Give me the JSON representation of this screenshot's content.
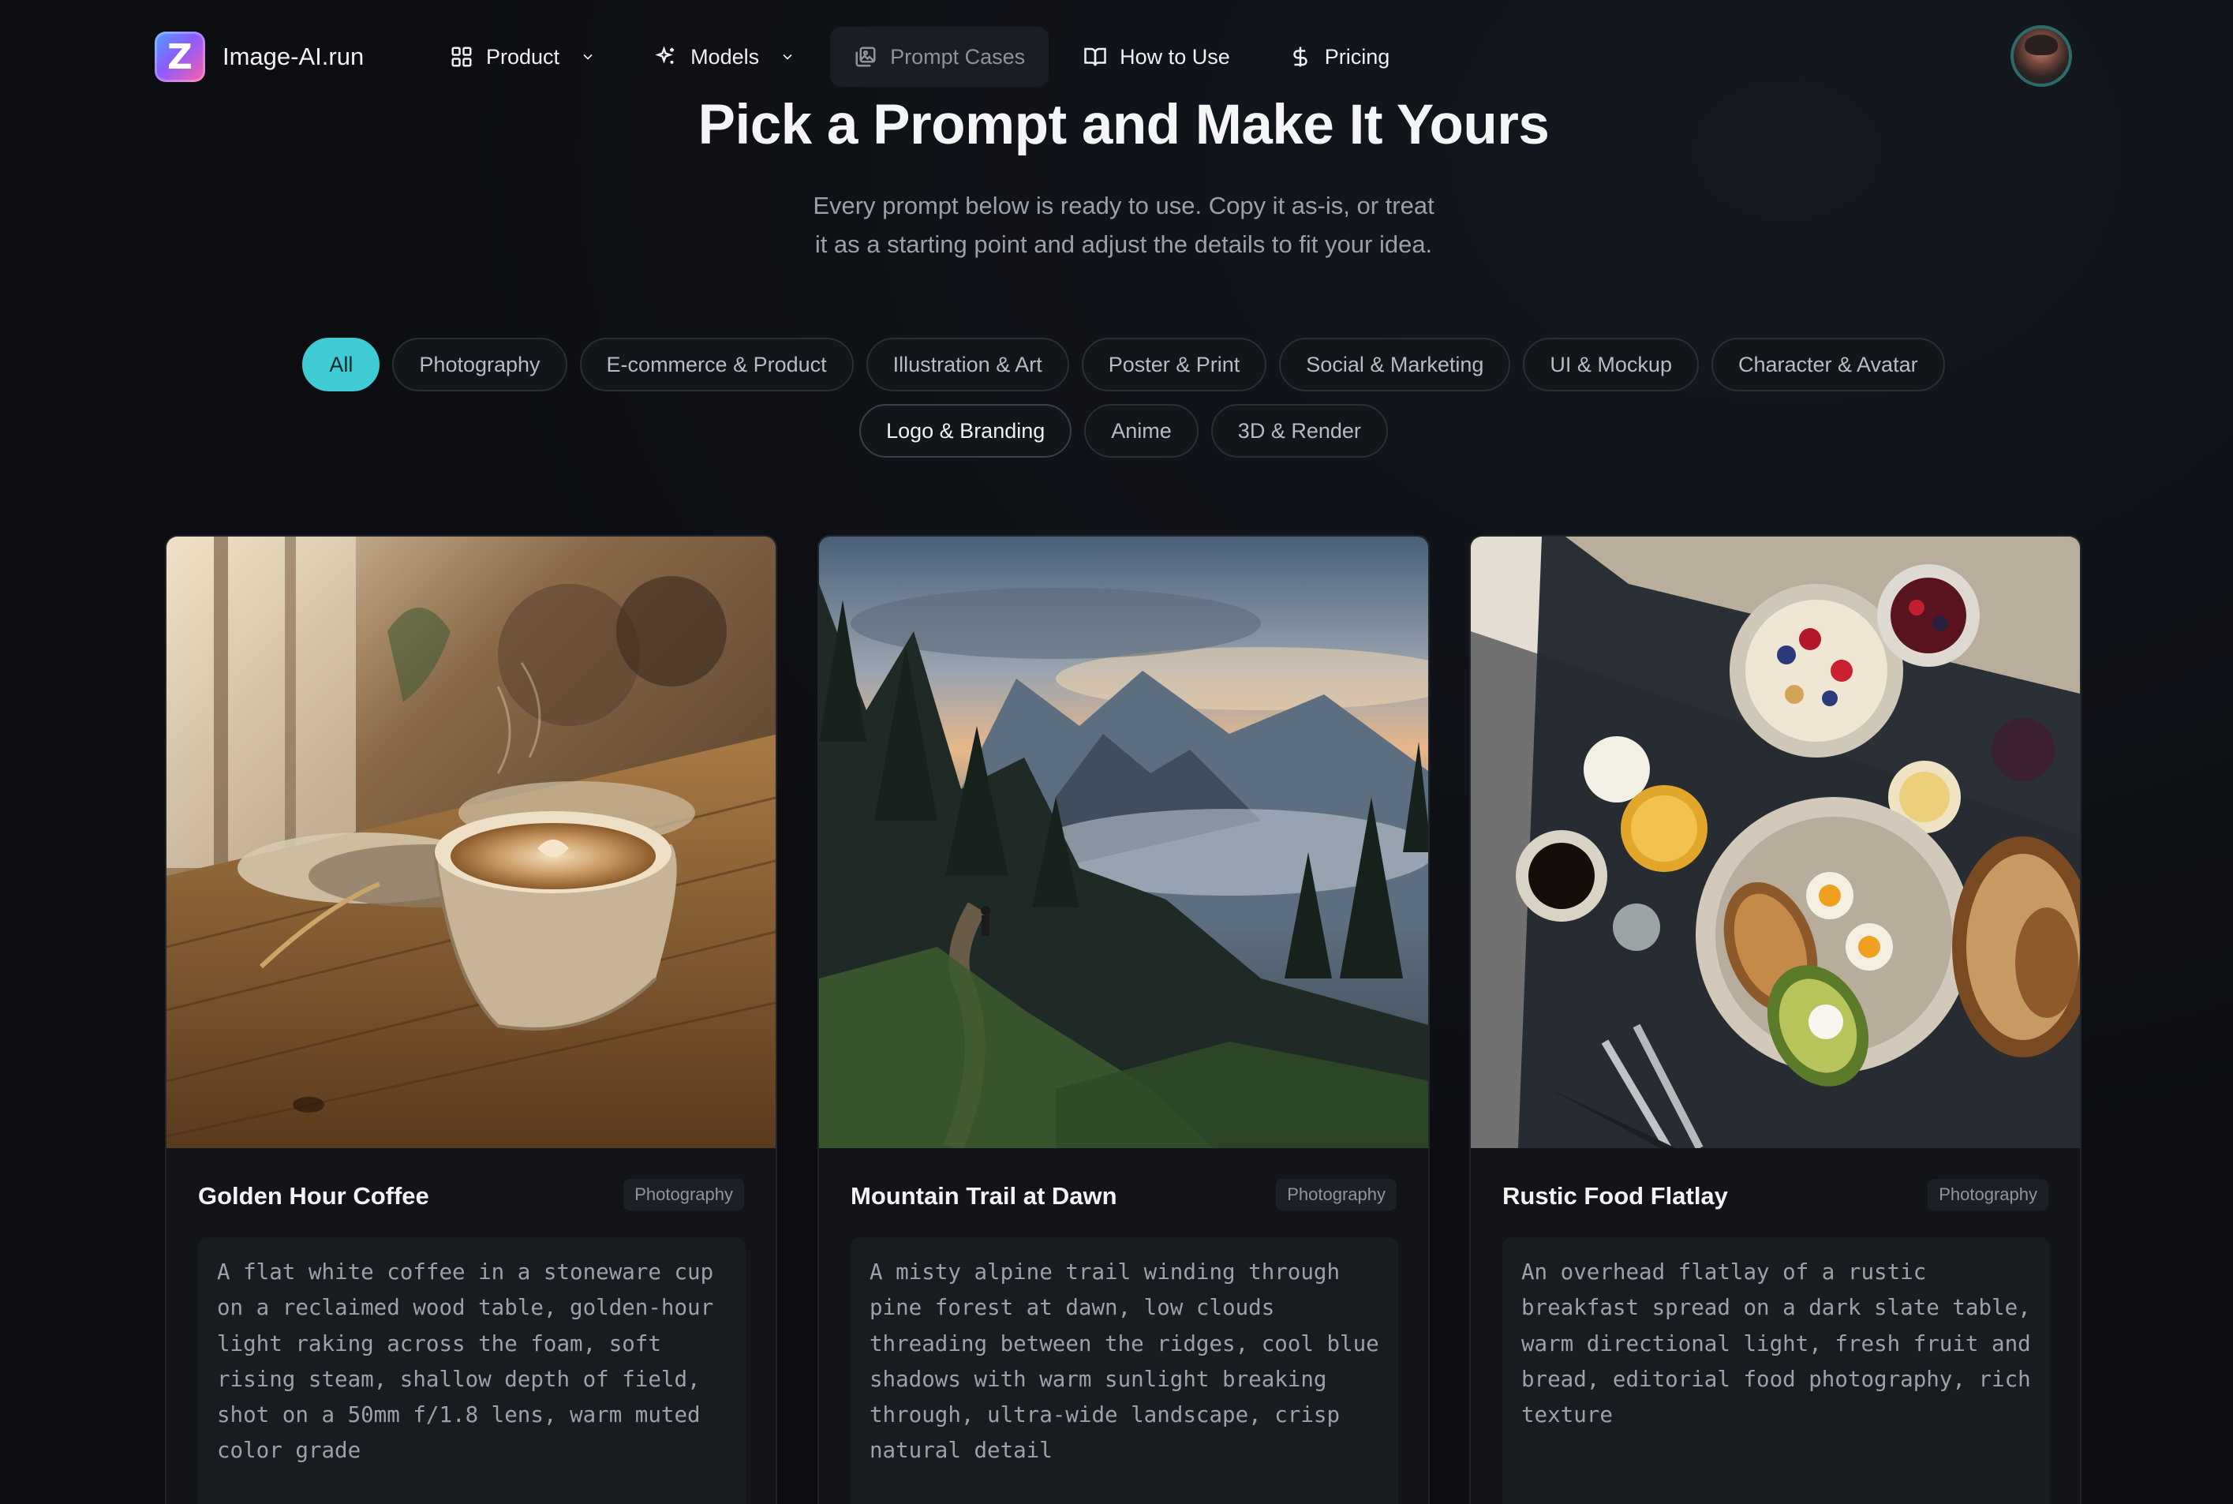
{
  "brand": {
    "name": "Image-AI.run",
    "logo_letter": "Z"
  },
  "nav": {
    "items": [
      {
        "label": "Product",
        "icon": "grid-icon",
        "dropdown": true,
        "active": false
      },
      {
        "label": "Models",
        "icon": "sparkle-icon",
        "dropdown": true,
        "active": false
      },
      {
        "label": "Prompt Cases",
        "icon": "gallery-icon",
        "dropdown": false,
        "active": true
      },
      {
        "label": "How to Use",
        "icon": "book-icon",
        "dropdown": false,
        "active": false
      },
      {
        "label": "Pricing",
        "icon": "dollar-icon",
        "dropdown": false,
        "active": false
      }
    ],
    "avatar_icon": "user-avatar"
  },
  "hero": {
    "title": "Pick a Prompt and Make It Yours",
    "subtitle_line1": "Every prompt below is ready to use. Copy it as-is, or treat",
    "subtitle_line2": "it as a starting point and adjust the details to fit your idea."
  },
  "filters": {
    "row1": [
      "All",
      "Photography",
      "E-commerce & Product",
      "Illustration & Art",
      "Poster & Print",
      "Social & Marketing",
      "UI & Mockup",
      "Character & Avatar"
    ],
    "row2": [
      "Logo & Branding",
      "Anime",
      "3D & Render"
    ],
    "selected": "All"
  },
  "cards": [
    {
      "title": "Golden Hour Coffee",
      "tag": "Photography",
      "prompt": "A flat white coffee in a stoneware cup on a reclaimed wood table, golden-hour light raking across the foam, soft rising steam, shallow depth of field, shot on a 50mm f/1.8 lens, warm muted color grade"
    },
    {
      "title": "Mountain Trail at Dawn",
      "tag": "Photography",
      "prompt": "A misty alpine trail winding through pine forest at dawn, low clouds threading between the ridges, cool blue shadows with warm sunlight breaking through, ultra-wide landscape, crisp natural detail"
    },
    {
      "title": "Rustic Food Flatlay",
      "tag": "Photography",
      "prompt": "An overhead flatlay of a rustic breakfast spread on a dark slate table, warm directional light, fresh fruit and bread, editorial food photography, rich texture"
    }
  ],
  "colors": {
    "accent": "#3ecbd4",
    "background": "#0c0e12",
    "card": "#121418"
  }
}
